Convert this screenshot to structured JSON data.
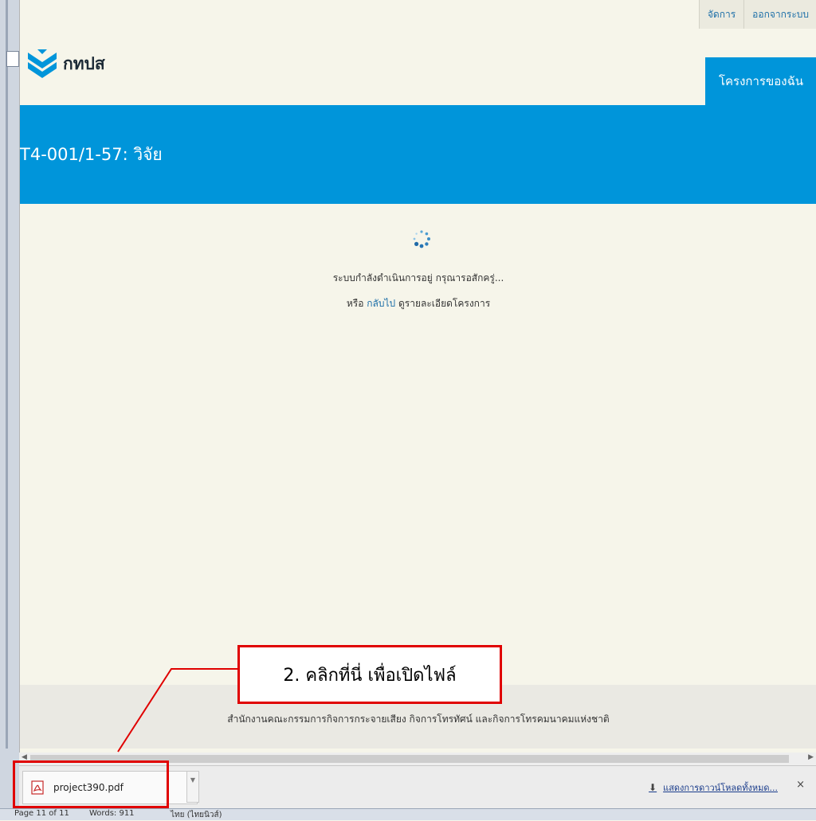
{
  "topnav": {
    "manage": "จัดการ",
    "logout": "ออกจากระบบ"
  },
  "logo": {
    "text": "กทปส",
    "icon": "chevron-logo-icon",
    "color": "#0095da"
  },
  "nav": {
    "my_projects": "โครงการของฉัน"
  },
  "banner": {
    "title": "T4-001/1-57: วิจัย",
    "color": "#0095da"
  },
  "status": {
    "loading": "ระบบกำลังดำเนินการอยู่ กรุณารอสักครู่...",
    "or": "หรือ",
    "back_link": "กลับไป",
    "back_suffix": "ดูรายละเอียดโครงการ"
  },
  "footer": {
    "text": "สำนักงานคณะกรรมการกิจการกระจายเสียง กิจการโทรทัศน์ และกิจการโทรคมนาคมแห่งชาติ"
  },
  "download": {
    "filename": "project390.pdf",
    "icon": "pdf-file-icon",
    "show_all": "แสดงการดาวน์โหลดทั้งหมด...",
    "close": "×"
  },
  "taskbar": {
    "page": "Page 11 of 11",
    "words": "Words: 911",
    "lang": "ไทย (ไทยนิวส์)"
  },
  "annotation": {
    "text": "2. คลิกที่นี่ เพื่อเปิดไฟล์",
    "color": "#e00000"
  }
}
